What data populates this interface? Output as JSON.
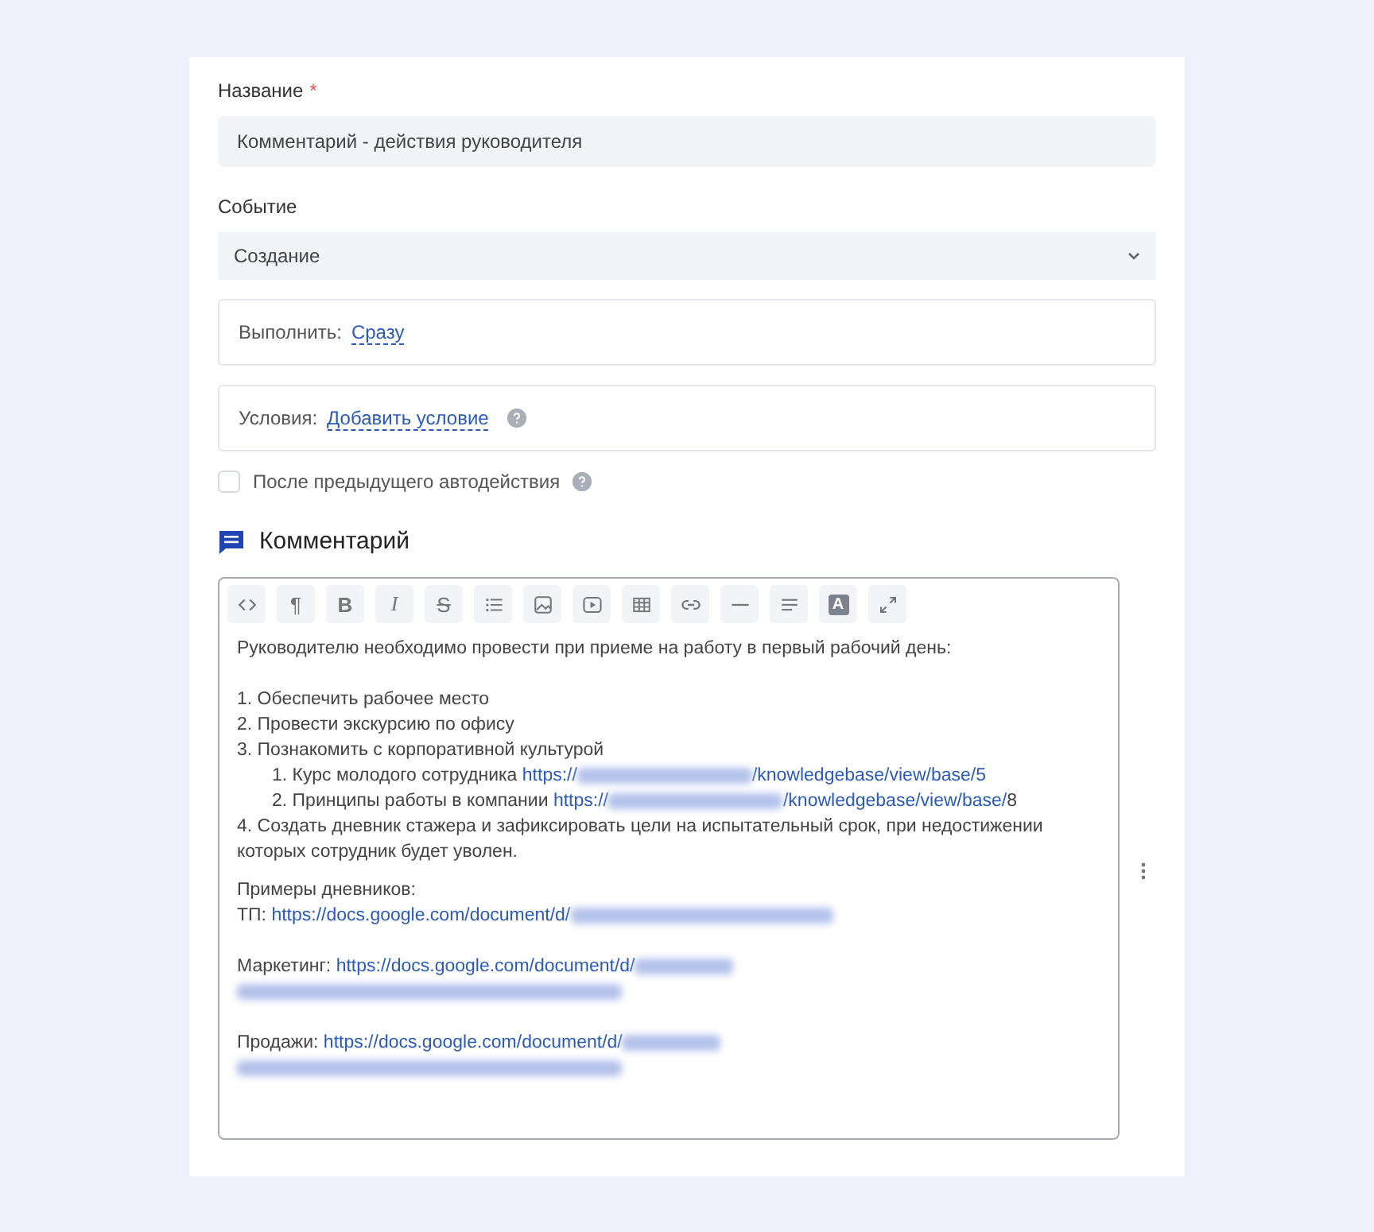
{
  "name_field": {
    "label": "Название",
    "required_mark": "*",
    "value": "Комментарий - действия руководителя"
  },
  "event_field": {
    "label": "Событие",
    "value": "Создание"
  },
  "execute": {
    "label": "Выполнить:",
    "link": "Сразу"
  },
  "conditions": {
    "label": "Условия:",
    "link": "Добавить условие"
  },
  "after_previous": {
    "label": "После предыдущего автодействия",
    "checked": false
  },
  "section": {
    "title": "Комментарий"
  },
  "toolbar": [
    {
      "kind": "code"
    },
    {
      "kind": "paragraph",
      "label": "¶"
    },
    {
      "kind": "bold",
      "label": "B"
    },
    {
      "kind": "italic",
      "label": "I"
    },
    {
      "kind": "strike",
      "label": "S"
    },
    {
      "kind": "list"
    },
    {
      "kind": "image"
    },
    {
      "kind": "video"
    },
    {
      "kind": "table"
    },
    {
      "kind": "link"
    },
    {
      "kind": "rule"
    },
    {
      "kind": "align"
    },
    {
      "kind": "color",
      "label": "A"
    },
    {
      "kind": "fullscreen"
    }
  ],
  "content": [
    {
      "lines": [
        {
          "segments": [
            {
              "kind": "text",
              "text": "Руководителю необходимо провести при приеме на работу в первый рабочий день:"
            }
          ]
        }
      ]
    },
    {
      "lines": [
        {
          "segments": [
            {
              "kind": "text",
              "text": "1. Обеспечить рабочее место"
            }
          ]
        },
        {
          "segments": [
            {
              "kind": "text",
              "text": "2. Провести экскурсию по офису"
            }
          ]
        },
        {
          "segments": [
            {
              "kind": "text",
              "text": "3. Познакомить с корпоративной культурой"
            }
          ],
          "children": [
            {
              "segments": [
                {
                  "kind": "text",
                  "text": "1. Курс молодого сотрудника "
                },
                {
                  "kind": "link",
                  "text": "https://"
                },
                {
                  "kind": "redacted"
                },
                {
                  "kind": "link",
                  "text": "/knowledgebase/view/base/5"
                }
              ]
            },
            {
              "segments": [
                {
                  "kind": "text",
                  "text": "2. Принципы работы в компании "
                },
                {
                  "kind": "link",
                  "text": "https://"
                },
                {
                  "kind": "redacted"
                },
                {
                  "kind": "link",
                  "text": "/knowledgebase/view/base/"
                },
                {
                  "kind": "text",
                  "text": "8"
                }
              ]
            }
          ]
        },
        {
          "segments": [
            {
              "kind": "text",
              "text": "4. Создать дневник стажера и зафиксировать цели на испытательный срок, при недостижении которых сотрудник будет уволен."
            }
          ]
        }
      ]
    },
    {
      "lines": [
        {
          "segments": [
            {
              "kind": "text",
              "text": "Примеры дневников:"
            }
          ]
        },
        {
          "segments": [
            {
              "kind": "text",
              "text": "ТП: "
            },
            {
              "kind": "link",
              "text": "https://docs.google.com/document/d/"
            },
            {
              "kind": "redacted"
            }
          ]
        }
      ]
    },
    {
      "lines": [
        {
          "segments": [
            {
              "kind": "text",
              "text": "Маркетинг: "
            },
            {
              "kind": "link",
              "text": "https://docs.google.com/document/d/"
            },
            {
              "kind": "redacted"
            }
          ]
        },
        {
          "segments": [
            {
              "kind": "redacted"
            }
          ]
        }
      ]
    },
    {
      "lines": [
        {
          "segments": [
            {
              "kind": "text",
              "text": "Продажи: "
            },
            {
              "kind": "link",
              "text": "https://docs.google.com/document/d/"
            },
            {
              "kind": "redacted"
            }
          ]
        },
        {
          "segments": [
            {
              "kind": "redacted"
            }
          ]
        }
      ]
    }
  ]
}
